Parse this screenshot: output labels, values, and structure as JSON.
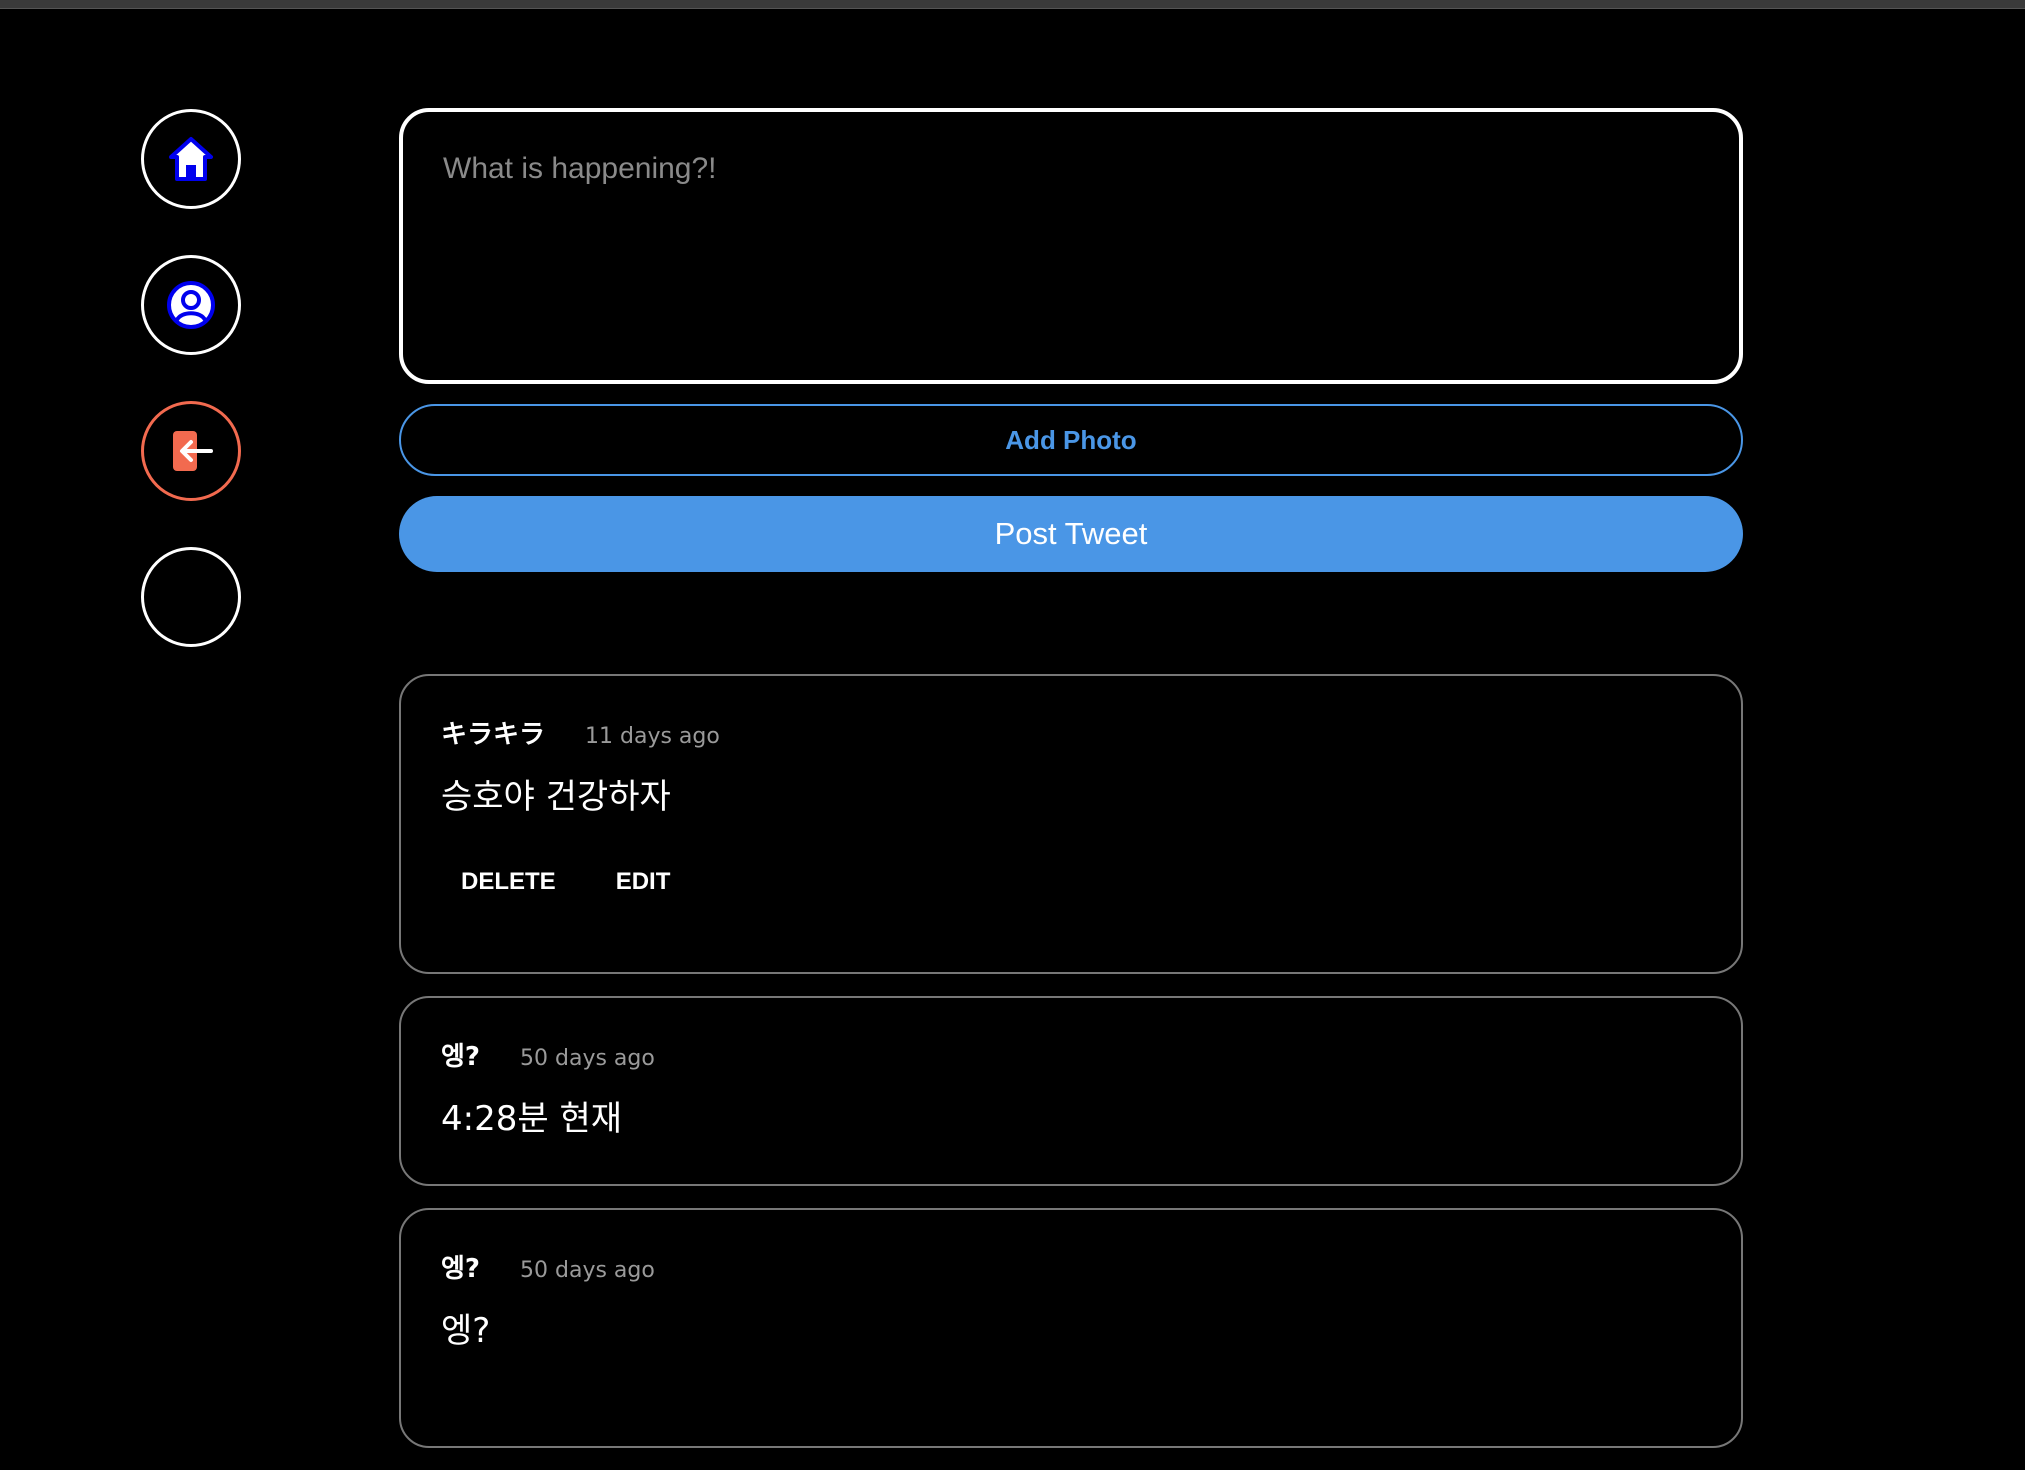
{
  "nav": {
    "items": [
      {
        "name": "home",
        "icon": "home-icon"
      },
      {
        "name": "profile",
        "icon": "user-icon"
      },
      {
        "name": "logout",
        "icon": "logout-icon"
      },
      {
        "name": "empty",
        "icon": ""
      }
    ]
  },
  "composer": {
    "placeholder": "What is happening?!",
    "add_photo_label": "Add Photo",
    "post_label": "Post Tweet"
  },
  "feed": {
    "tweets": [
      {
        "username": "キラキラ",
        "time": "11 days ago",
        "text": "승호야 건강하자",
        "delete_label": "DELETE",
        "edit_label": "EDIT"
      },
      {
        "username": "엥?",
        "time": "50 days ago",
        "text": "4:28분 현재"
      },
      {
        "username": "엥?",
        "time": "50 days ago",
        "text": "엥?"
      }
    ]
  },
  "colors": {
    "accent": "#4a96e6",
    "logout": "#f26a4f",
    "icon_blue": "#0000ee"
  }
}
